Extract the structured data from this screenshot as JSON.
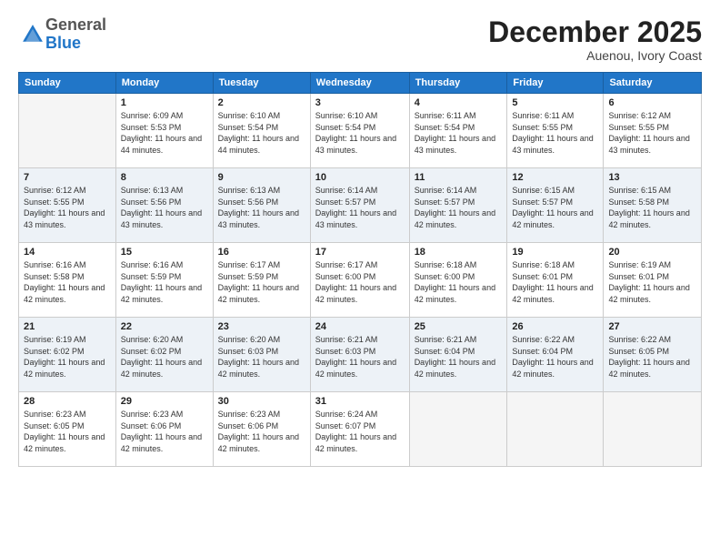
{
  "logo": {
    "general": "General",
    "blue": "Blue"
  },
  "title": "December 2025",
  "location": "Auenou, Ivory Coast",
  "days_of_week": [
    "Sunday",
    "Monday",
    "Tuesday",
    "Wednesday",
    "Thursday",
    "Friday",
    "Saturday"
  ],
  "weeks": [
    [
      {
        "day": "",
        "sunrise": "",
        "sunset": "",
        "daylight": ""
      },
      {
        "day": "1",
        "sunrise": "6:09 AM",
        "sunset": "5:53 PM",
        "daylight": "11 hours and 44 minutes."
      },
      {
        "day": "2",
        "sunrise": "6:10 AM",
        "sunset": "5:54 PM",
        "daylight": "11 hours and 44 minutes."
      },
      {
        "day": "3",
        "sunrise": "6:10 AM",
        "sunset": "5:54 PM",
        "daylight": "11 hours and 43 minutes."
      },
      {
        "day": "4",
        "sunrise": "6:11 AM",
        "sunset": "5:54 PM",
        "daylight": "11 hours and 43 minutes."
      },
      {
        "day": "5",
        "sunrise": "6:11 AM",
        "sunset": "5:55 PM",
        "daylight": "11 hours and 43 minutes."
      },
      {
        "day": "6",
        "sunrise": "6:12 AM",
        "sunset": "5:55 PM",
        "daylight": "11 hours and 43 minutes."
      }
    ],
    [
      {
        "day": "7",
        "sunrise": "6:12 AM",
        "sunset": "5:55 PM",
        "daylight": "11 hours and 43 minutes."
      },
      {
        "day": "8",
        "sunrise": "6:13 AM",
        "sunset": "5:56 PM",
        "daylight": "11 hours and 43 minutes."
      },
      {
        "day": "9",
        "sunrise": "6:13 AM",
        "sunset": "5:56 PM",
        "daylight": "11 hours and 43 minutes."
      },
      {
        "day": "10",
        "sunrise": "6:14 AM",
        "sunset": "5:57 PM",
        "daylight": "11 hours and 43 minutes."
      },
      {
        "day": "11",
        "sunrise": "6:14 AM",
        "sunset": "5:57 PM",
        "daylight": "11 hours and 42 minutes."
      },
      {
        "day": "12",
        "sunrise": "6:15 AM",
        "sunset": "5:57 PM",
        "daylight": "11 hours and 42 minutes."
      },
      {
        "day": "13",
        "sunrise": "6:15 AM",
        "sunset": "5:58 PM",
        "daylight": "11 hours and 42 minutes."
      }
    ],
    [
      {
        "day": "14",
        "sunrise": "6:16 AM",
        "sunset": "5:58 PM",
        "daylight": "11 hours and 42 minutes."
      },
      {
        "day": "15",
        "sunrise": "6:16 AM",
        "sunset": "5:59 PM",
        "daylight": "11 hours and 42 minutes."
      },
      {
        "day": "16",
        "sunrise": "6:17 AM",
        "sunset": "5:59 PM",
        "daylight": "11 hours and 42 minutes."
      },
      {
        "day": "17",
        "sunrise": "6:17 AM",
        "sunset": "6:00 PM",
        "daylight": "11 hours and 42 minutes."
      },
      {
        "day": "18",
        "sunrise": "6:18 AM",
        "sunset": "6:00 PM",
        "daylight": "11 hours and 42 minutes."
      },
      {
        "day": "19",
        "sunrise": "6:18 AM",
        "sunset": "6:01 PM",
        "daylight": "11 hours and 42 minutes."
      },
      {
        "day": "20",
        "sunrise": "6:19 AM",
        "sunset": "6:01 PM",
        "daylight": "11 hours and 42 minutes."
      }
    ],
    [
      {
        "day": "21",
        "sunrise": "6:19 AM",
        "sunset": "6:02 PM",
        "daylight": "11 hours and 42 minutes."
      },
      {
        "day": "22",
        "sunrise": "6:20 AM",
        "sunset": "6:02 PM",
        "daylight": "11 hours and 42 minutes."
      },
      {
        "day": "23",
        "sunrise": "6:20 AM",
        "sunset": "6:03 PM",
        "daylight": "11 hours and 42 minutes."
      },
      {
        "day": "24",
        "sunrise": "6:21 AM",
        "sunset": "6:03 PM",
        "daylight": "11 hours and 42 minutes."
      },
      {
        "day": "25",
        "sunrise": "6:21 AM",
        "sunset": "6:04 PM",
        "daylight": "11 hours and 42 minutes."
      },
      {
        "day": "26",
        "sunrise": "6:22 AM",
        "sunset": "6:04 PM",
        "daylight": "11 hours and 42 minutes."
      },
      {
        "day": "27",
        "sunrise": "6:22 AM",
        "sunset": "6:05 PM",
        "daylight": "11 hours and 42 minutes."
      }
    ],
    [
      {
        "day": "28",
        "sunrise": "6:23 AM",
        "sunset": "6:05 PM",
        "daylight": "11 hours and 42 minutes."
      },
      {
        "day": "29",
        "sunrise": "6:23 AM",
        "sunset": "6:06 PM",
        "daylight": "11 hours and 42 minutes."
      },
      {
        "day": "30",
        "sunrise": "6:23 AM",
        "sunset": "6:06 PM",
        "daylight": "11 hours and 42 minutes."
      },
      {
        "day": "31",
        "sunrise": "6:24 AM",
        "sunset": "6:07 PM",
        "daylight": "11 hours and 42 minutes."
      },
      {
        "day": "",
        "sunrise": "",
        "sunset": "",
        "daylight": ""
      },
      {
        "day": "",
        "sunrise": "",
        "sunset": "",
        "daylight": ""
      },
      {
        "day": "",
        "sunrise": "",
        "sunset": "",
        "daylight": ""
      }
    ]
  ],
  "labels": {
    "sunrise": "Sunrise:",
    "sunset": "Sunset:",
    "daylight": "Daylight:"
  },
  "accent_color": "#2176c8"
}
